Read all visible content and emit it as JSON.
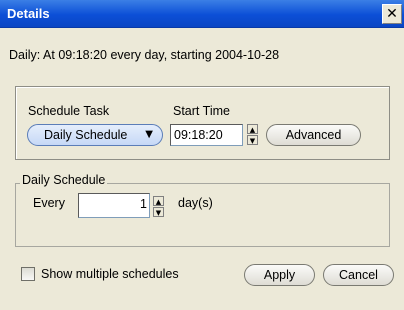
{
  "window": {
    "title": "Details",
    "close_glyph": "✕"
  },
  "summary": "Daily: At 09:18:20 every day, starting 2004-10-28",
  "schedule": {
    "task_label": "Schedule Task",
    "task_value": "Daily Schedule",
    "start_label": "Start Time",
    "start_value": "09:18:20",
    "advanced_label": "Advanced"
  },
  "daily": {
    "group_label": "Daily Schedule",
    "every_label": "Every",
    "every_value": "1",
    "unit_label": "day(s)"
  },
  "footer": {
    "show_multiple_label": "Show multiple schedules",
    "show_multiple_checked": false,
    "apply_label": "Apply",
    "cancel_label": "Cancel"
  },
  "icons": {
    "dropdown": "chevron-down-icon",
    "spin_up": "triangle-up-icon",
    "spin_down": "triangle-down-icon"
  }
}
